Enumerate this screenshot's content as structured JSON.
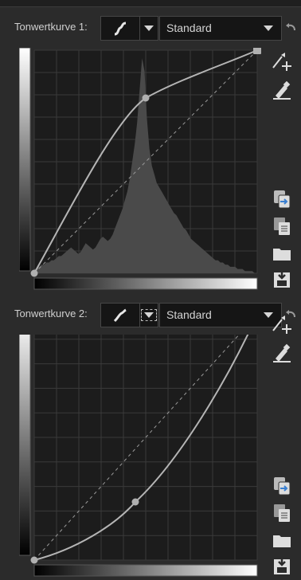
{
  "curve1": {
    "label": "Tonwertkurve 1:",
    "preset": "Standard",
    "histogram": [
      2,
      2,
      3,
      4,
      4,
      5,
      5,
      6,
      6,
      7,
      8,
      8,
      9,
      10,
      11,
      12,
      11,
      10,
      9,
      10,
      12,
      14,
      13,
      12,
      11,
      12,
      14,
      16,
      17,
      16,
      15,
      16,
      18,
      21,
      24,
      27,
      30,
      34,
      38,
      44,
      52,
      60,
      70,
      85,
      100,
      94,
      72,
      58,
      50,
      46,
      42,
      40,
      38,
      36,
      34,
      32,
      30,
      28,
      27,
      25,
      23,
      21,
      20,
      18,
      16,
      15,
      14,
      13,
      12,
      11,
      10,
      9,
      8,
      7,
      6,
      6,
      5,
      5,
      4,
      4,
      3,
      3,
      3,
      2,
      2,
      2,
      1,
      1,
      1,
      1,
      0,
      0
    ]
  },
  "curve2": {
    "label": "Tonwertkurve 2:",
    "preset": "Standard"
  },
  "icons": {
    "curve_type": "curve-shape-icon",
    "dropdown": "chevron-down-icon",
    "reset": "reset-arrow-icon",
    "pick_point": "pick-point-from-image-icon",
    "eyedropper": "eyedropper-icon",
    "copy": "copy-curve-icon",
    "paste": "paste-curve-icon",
    "open": "open-folder-icon",
    "save": "save-icon"
  }
}
